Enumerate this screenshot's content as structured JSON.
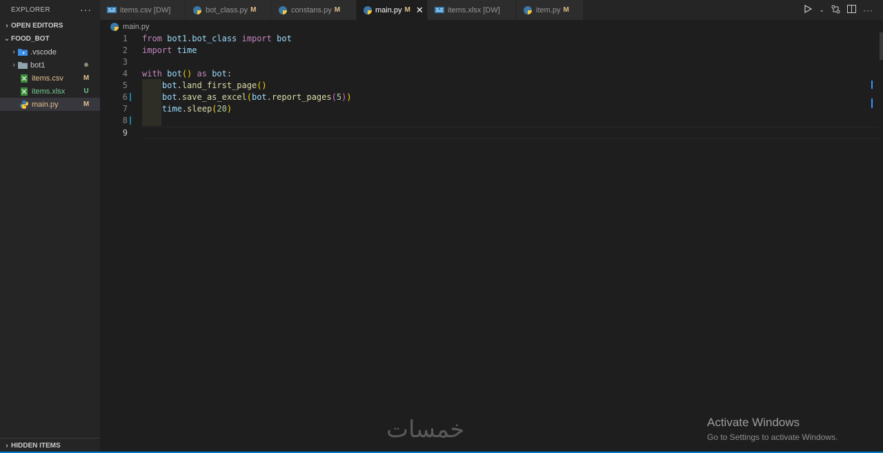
{
  "sidebar": {
    "title": "EXPLORER",
    "more_icon": "ellipsis-icon",
    "open_editors_label": "OPEN EDITORS",
    "folder_label": "FOOD_BOT",
    "items": [
      {
        "name": ".vscode",
        "type": "folder",
        "badge": ""
      },
      {
        "name": "bot1",
        "type": "folder",
        "badge": ""
      },
      {
        "name": "items.csv",
        "type": "file",
        "badge": "M"
      },
      {
        "name": "items.xlsx",
        "type": "file",
        "badge": "U"
      },
      {
        "name": "main.py",
        "type": "file",
        "badge": "M"
      }
    ],
    "hidden_label": "HIDDEN ITEMS"
  },
  "tabs": [
    {
      "label": "items.csv [DW]",
      "badge": ""
    },
    {
      "label": "bot_class.py",
      "badge": "M"
    },
    {
      "label": "constans.py",
      "badge": "M"
    },
    {
      "label": "main.py",
      "badge": "M"
    },
    {
      "label": "items.xlsx [DW]",
      "badge": ""
    },
    {
      "label": "item.py",
      "badge": "M"
    }
  ],
  "breadcrumb": "main.py",
  "line_numbers": [
    "1",
    "2",
    "3",
    "4",
    "5",
    "6",
    "7",
    "8",
    "9"
  ],
  "code": {
    "l1": {
      "from": "from",
      "mod": "bot1.bot_class",
      "imp": "import",
      "name": "bot"
    },
    "l2": {
      "imp": "import",
      "name": "time"
    },
    "l4": {
      "with": "with",
      "call": "bot",
      "parens": "()",
      "as": "as",
      "alias": "bot",
      "colon": ":"
    },
    "l5": {
      "obj": "bot",
      "dot": ".",
      "fn": "land_first_page",
      "parens": "()"
    },
    "l6": {
      "obj": "bot",
      "dot": ".",
      "fn": "save_as_excel",
      "open": "(",
      "obj2": "bot",
      "dot2": ".",
      "fn2": "report_pages",
      "open2": "(",
      "num": "5",
      "close2": ")",
      "close": ")"
    },
    "l7": {
      "obj": "time",
      "dot": ".",
      "fn": "sleep",
      "open": "(",
      "num": "20",
      "close": ")"
    }
  },
  "activation": {
    "title": "Activate Windows",
    "subtitle": "Go to Settings to activate Windows."
  },
  "watermark": "خمسات",
  "colors": {
    "accent": "#007acc",
    "modified": "#e2c08d",
    "untracked": "#73c991",
    "keyword": "#c586c0",
    "variable": "#9cdcfe",
    "function": "#dcdcaa",
    "number": "#b5cea8"
  }
}
